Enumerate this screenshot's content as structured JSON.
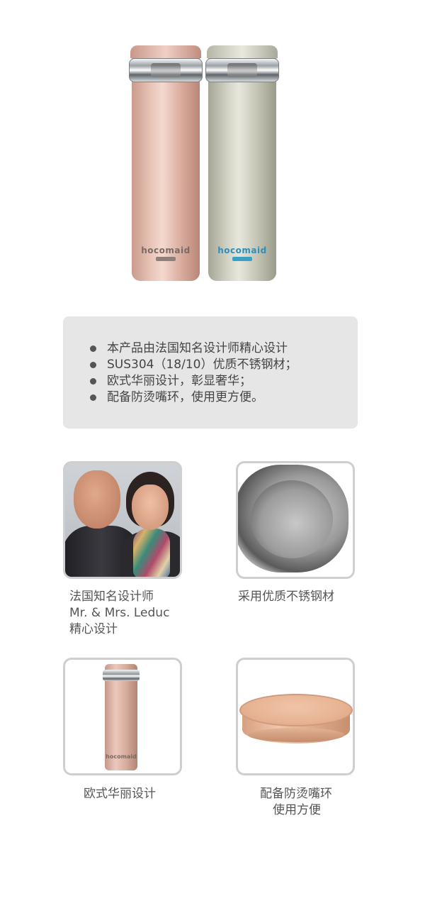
{
  "hero": {
    "bottles": [
      {
        "logo": "hocomaid",
        "color": "#e4bdaf"
      },
      {
        "logo": "hocomaid",
        "color": "#d8d8cc"
      }
    ]
  },
  "features": {
    "items": [
      "本产品由法国知名设计师精心设计",
      "SUS304（18/10）优质不锈钢材；",
      "欧式华丽设计，彰显奢华；",
      "配备防烫嘴环，使用更方便。"
    ]
  },
  "tiles": {
    "designer": {
      "line1": "法国知名设计师",
      "line2": "Mr. & Mrs. Leduc",
      "line3": "精心设计"
    },
    "steel": {
      "caption": "采用优质不锈钢材"
    },
    "design": {
      "caption": "欧式华丽设计",
      "logo": "hocomaid"
    },
    "lid": {
      "line1": "配备防烫嘴环",
      "line2": "使用方便"
    }
  },
  "colors": {
    "accent_box": "#e6e6e6",
    "tile_border": "#cfcfcf",
    "text": "#555555"
  }
}
